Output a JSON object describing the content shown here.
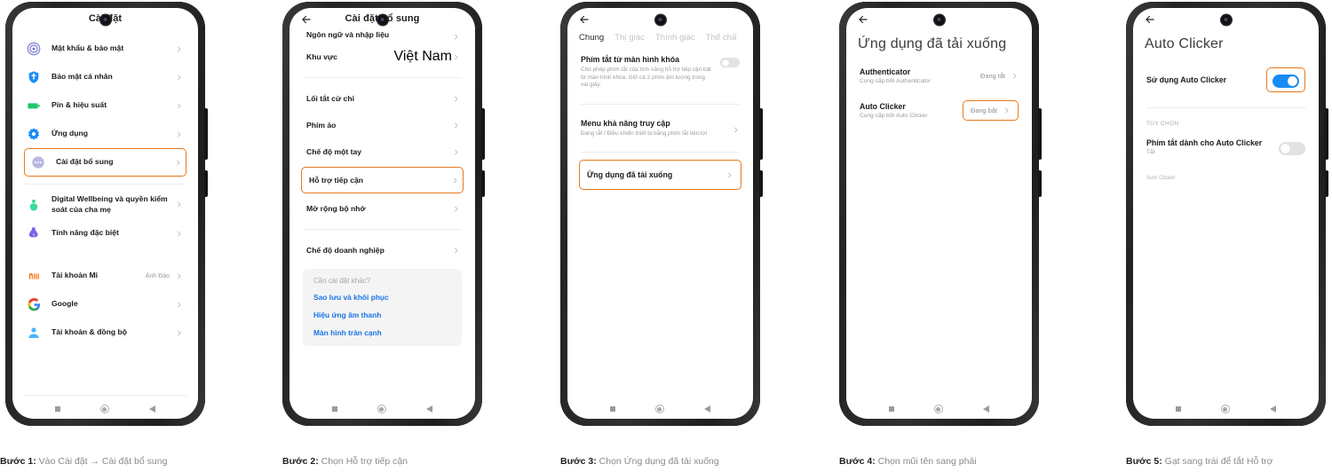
{
  "meta": {
    "accent": "#e8791c",
    "link_blue": "#1a73e8",
    "toggle_on": "#1a8cf5"
  },
  "phones": [
    {
      "id": "phone-1",
      "header_title": "Cài đặt",
      "caption_step": "Bước 1:",
      "caption_text": "Vào Cài đặt → Cài đặt bổ sung",
      "items": [
        {
          "label": "Mật khẩu & bảo mật",
          "icon": "fingerprint-icon",
          "value": "",
          "highlight": false
        },
        {
          "label": "Bảo mật cá nhân",
          "icon": "shield-icon",
          "value": "",
          "highlight": false
        },
        {
          "label": "Pin & hiệu suất",
          "icon": "battery-icon",
          "value": "",
          "highlight": false
        },
        {
          "label": "Ứng dụng",
          "icon": "gear-icon",
          "value": "",
          "highlight": false
        },
        {
          "label": "Cài đặt bổ sung",
          "icon": "dots-icon",
          "value": "",
          "highlight": true
        },
        {
          "label": "Digital Wellbeing và quyền kiểm soát của cha mẹ",
          "icon": "wellbeing-icon",
          "value": "",
          "highlight": false
        },
        {
          "label": "Tính năng đặc biệt",
          "icon": "special-icon",
          "value": "",
          "highlight": false
        },
        {
          "label": "Tài khoản Mi",
          "icon": "mi-logo-icon",
          "value": "Ánh Đào",
          "highlight": false
        },
        {
          "label": "Google",
          "icon": "google-logo-icon",
          "value": "",
          "highlight": false
        },
        {
          "label": "Tài khoản & đồng bộ",
          "icon": "account-icon",
          "value": "",
          "highlight": false
        }
      ]
    },
    {
      "id": "phone-2",
      "header_title": "Cài đặt bổ sung",
      "caption_step": "Bước 2:",
      "caption_text": "Chọn Hỗ trợ tiếp cận",
      "items": [
        {
          "label": "Ngôn ngữ và nhập liệu",
          "value": "",
          "highlight": false,
          "clipped": true
        },
        {
          "label": "Khu vực",
          "value": "Việt Nam",
          "highlight": false
        },
        {
          "label": "Lối tắt cử chỉ",
          "value": "",
          "highlight": false
        },
        {
          "label": "Phím ảo",
          "value": "",
          "highlight": false
        },
        {
          "label": "Chế độ một tay",
          "value": "",
          "highlight": false
        },
        {
          "label": "Hỗ trợ tiếp cận",
          "value": "",
          "highlight": true
        },
        {
          "label": "Mở rộng bộ nhớ",
          "value": "",
          "highlight": false
        },
        {
          "label": "Chế độ doanh nghiệp",
          "value": "",
          "highlight": false
        }
      ],
      "other_box": {
        "header": "Cần cài đặt khác?",
        "links": [
          "Sao lưu và khôi phục",
          "Hiệu ứng âm thanh",
          "Màn hình tràn cạnh"
        ]
      }
    },
    {
      "id": "phone-3",
      "caption_step": "Bước 3:",
      "caption_text": "Chọn Ứng dụng đã tải xuống",
      "tabs": [
        {
          "label": "Chung",
          "active": true
        },
        {
          "label": "Thị giác",
          "active": false
        },
        {
          "label": "Thính giác",
          "active": false
        },
        {
          "label": "Thể chấ",
          "active": false
        }
      ],
      "rows": [
        {
          "title": "Phím tắt từ màn hình khóa",
          "subtitle": "Cho phép phím tắt của tính năng hỗ trợ tiếp cận bật từ màn hình khóa. Giữ cả 2 phím âm lượng trong vài giây.",
          "control": "toggle-off",
          "highlight": false
        },
        {
          "title": "Menu khả năng truy cập",
          "subtitle": "Đang tắt / Điều khiển thiết bị bằng phím tắt tiện lợi",
          "control": "chevron",
          "highlight": false
        },
        {
          "title": "Ứng dụng đã tải xuống",
          "subtitle": "",
          "control": "chevron",
          "highlight": true
        }
      ]
    },
    {
      "id": "phone-4",
      "header_title": "Ứng dụng đã tải xuống",
      "caption_step": "Bước 4:",
      "caption_text": "Chọn mũi tên sang phải",
      "apps": [
        {
          "name": "Authenticator",
          "provider": "Cung cấp bởi Authenticator",
          "state": "Đang tắt",
          "highlight": false
        },
        {
          "name": "Auto Clicker",
          "provider": "Cung cấp bởi Auto Clicker",
          "state": "Đang bật",
          "highlight": true
        }
      ]
    },
    {
      "id": "phone-5",
      "header_title": "Auto Clicker",
      "caption_step": "Bước 5:",
      "caption_text": "Gạt sang trái để tắt Hỗ trợ",
      "main_row": {
        "label": "Sử dụng Auto Clicker",
        "control": "toggle-on",
        "highlight": true
      },
      "section_header": "TÙY CHỌN",
      "option_row": {
        "label": "Phím tắt dành cho Auto Clicker",
        "subtitle": "Tắt",
        "control": "toggle-off"
      },
      "footer_note": "Auto Clicker"
    }
  ],
  "nav": {
    "recents": "square-icon",
    "home": "circle-icon",
    "back": "triangle-back-icon"
  }
}
